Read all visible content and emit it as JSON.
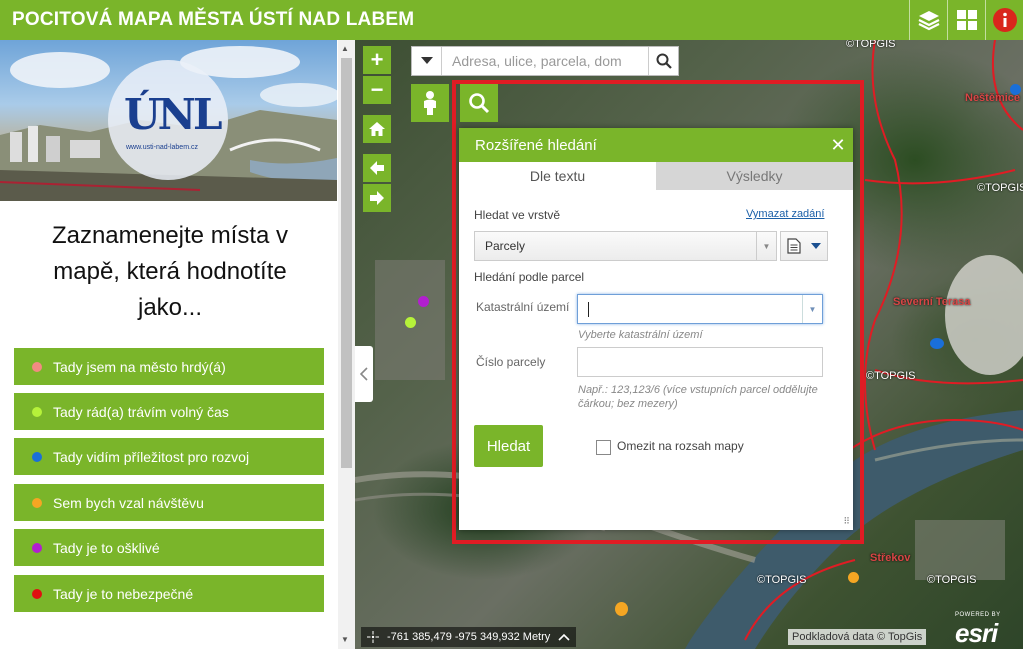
{
  "header": {
    "title": "POCITOVÁ MAPA MĚSTA ÚSTÍ NAD LABEM",
    "colors": {
      "green": "#7ab52a",
      "info_red": "#d9261c"
    }
  },
  "banner": {
    "logo_text": "ÚNL",
    "logo_url": "www.usti-nad-labem.cz"
  },
  "intro": {
    "text": "Zaznamenejte místa v mapě, která hodnotíte jako..."
  },
  "legend": [
    {
      "label": "Tady jsem na město hrdý(á)",
      "color": "#f28b82"
    },
    {
      "label": "Tady rád(a) trávím volný čas",
      "color": "#b6f23a"
    },
    {
      "label": "Tady vidím příležitost pro rozvoj",
      "color": "#1a6fd9"
    },
    {
      "label": "Sem bych vzal návštěvu",
      "color": "#f5a623"
    },
    {
      "label": "Tady je to ošklivé",
      "color": "#b21fcf"
    },
    {
      "label": "Tady je to nebezpečné",
      "color": "#e01010"
    }
  ],
  "map": {
    "zoom_in": "+",
    "zoom_out": "−",
    "search_placeholder": "Adresa, ulice, parcela, dom",
    "coordinates": "-761 385,479 -975 349,932 Metry",
    "attribution": "Podkladová data © TopGis",
    "esri_powered": "POWERED BY",
    "esri_logo": "esri",
    "places": [
      {
        "label": "Neštěmice",
        "style": "red"
      },
      {
        "label": "Severní Terasa",
        "style": "red"
      },
      {
        "label": "Střekov",
        "style": "red"
      },
      {
        "label": "©TOPGIS",
        "style": "plain"
      }
    ]
  },
  "dialog": {
    "title": "Rozšířené hledání",
    "tabs": [
      {
        "label": "Dle textu",
        "active": true
      },
      {
        "label": "Výsledky",
        "active": false
      }
    ],
    "layer_label": "Hledat ve vrstvě",
    "clear_link": "Vymazat zadání",
    "layer_value": "Parcely",
    "section_label": "Hledání podle parcel",
    "cadastre_label": "Katastrální území",
    "cadastre_value": "",
    "cadastre_hint": "Vyberte katastrální území",
    "parcel_label": "Číslo parcely",
    "parcel_value": "",
    "parcel_hint": "Např.: 123,123/6 (více vstupních parcel oddělujte čárkou; bez mezery)",
    "search_button": "Hledat",
    "limit_label": "Omezit na rozsah mapy",
    "limit_checked": false
  }
}
